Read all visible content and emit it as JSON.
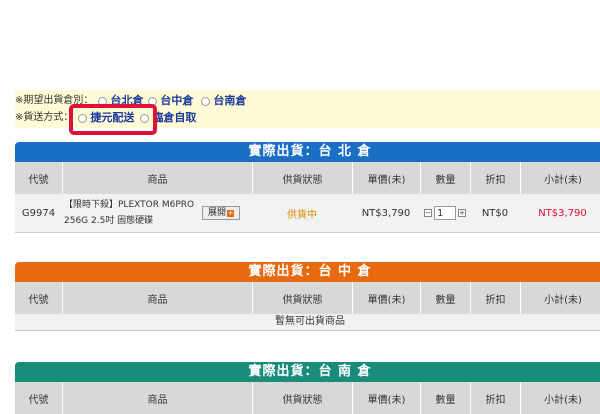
{
  "shipping_options": {
    "pickup_label": "※期望出貨倉別：",
    "pickup_options": [
      "台北倉",
      "台中倉",
      "台南倉"
    ],
    "delivery_label": "※貨送方式：",
    "delivery_options": [
      "捷元配送",
      "臨倉自取"
    ]
  },
  "columns": [
    "代號",
    "商品",
    "供貨狀態",
    "單價(未)",
    "數量",
    "折扣",
    "小計(未)"
  ],
  "warehouses": [
    {
      "title": "實際出貨：台 北 倉",
      "color": "#1a6fc4",
      "rows": [
        {
          "code": "G9974",
          "name_line1": "【限時下殺】PLEXTOR M6PRO",
          "name_line2": "256G 2.5吋 固態硬碟",
          "expand_label": "展開",
          "status": "供貨中",
          "price": "NT$3,790",
          "qty": "1",
          "discount": "NT$0",
          "subtotal": "NT$3,790"
        }
      ]
    },
    {
      "title": "實際出貨：台 中 倉",
      "color": "#e86a10",
      "empty_text": "暫無可出貨商品"
    },
    {
      "title": "實際出貨：台 南 倉",
      "color": "#1a8c7c"
    }
  ]
}
